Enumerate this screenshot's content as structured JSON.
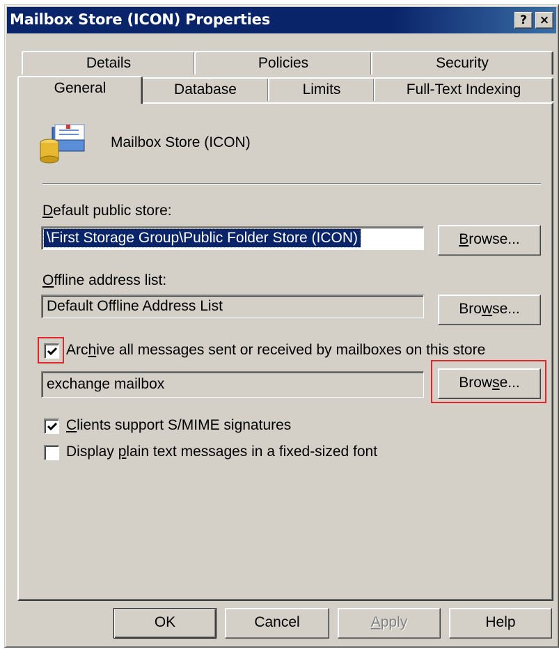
{
  "window": {
    "title": "Mailbox Store (ICON) Properties",
    "help_button": "?",
    "close_button": "×"
  },
  "tabs": {
    "row1": [
      {
        "label": "Details"
      },
      {
        "label": "Policies"
      },
      {
        "label": "Security"
      }
    ],
    "row2": [
      {
        "label": "General",
        "active": true
      },
      {
        "label": "Database"
      },
      {
        "label": "Limits"
      },
      {
        "label": "Full-Text Indexing"
      }
    ]
  },
  "general": {
    "store_name": "Mailbox Store (ICON)",
    "store_icon": "mailbox-store-icon",
    "default_public_store": {
      "label": "Default public store:",
      "accel": "D",
      "value": "\\First Storage Group\\Public Folder Store (ICON)",
      "browse": "Browse..."
    },
    "offline_address_list": {
      "label": "Offline address list:",
      "accel": "O",
      "value": "Default Offline Address List",
      "browse": "Browse..."
    },
    "archive": {
      "checked": true,
      "label": "Archive all messages sent or received by mailboxes on this store",
      "value": "exchange mailbox",
      "browse": "Browse..."
    },
    "smime": {
      "checked": true,
      "label": "Clients support S/MIME signatures"
    },
    "plain_text_font": {
      "checked": false,
      "label": "Display plain text messages in a fixed-sized font"
    }
  },
  "footer": {
    "ok": "OK",
    "cancel": "Cancel",
    "apply": "Apply",
    "help": "Help"
  },
  "colors": {
    "titlebar": "#0a246a",
    "dialog_face": "#d4d0c8",
    "highlight_annotation": "#e0262b"
  }
}
